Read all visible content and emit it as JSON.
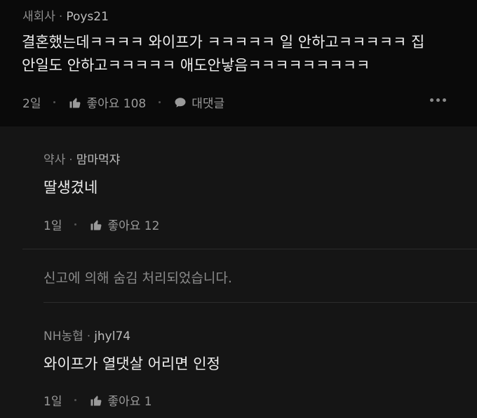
{
  "comment": {
    "company": "새회사",
    "nickname": "Poys21",
    "text_line1": "결혼했는데ㅋㅋㅋㅋ 와이프가 ㅋㅋㅋㅋㅋ 일 안하고ㅋㅋㅋㅋㅋ 집",
    "text_line2": "안일도 안하고ㅋㅋㅋㅋㅋ 애도안낳음ㅋㅋㅋㅋㅋㅋㅋㅋㅋ",
    "time": "2일",
    "like_label": "좋아요 108",
    "reply_label": "대댓글"
  },
  "replies": [
    {
      "company": "약사",
      "nickname": "맘마먹쟈",
      "text": "딸생겼네",
      "time": "1일",
      "like_label": "좋아요 12"
    },
    {
      "hidden_notice": "신고에 의해 숨김 처리되었습니다."
    },
    {
      "company": "NH농협",
      "nickname": "jhyl74",
      "text": "와이프가 열댓살 어리면 인정",
      "time": "1일",
      "like_label": "좋아요 1"
    }
  ],
  "colors": {
    "background": "#0e0e0e",
    "reply_background": "#151515",
    "text": "#eeeeee",
    "muted": "#8c8c8c"
  },
  "icons": {
    "like": "thumbs-up-icon",
    "reply": "speech-bubble-icon",
    "more": "more-horizontal-icon"
  }
}
